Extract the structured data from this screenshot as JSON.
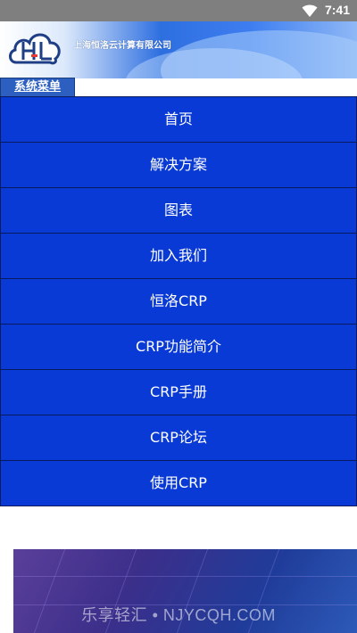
{
  "status_bar": {
    "time": "7:41",
    "icons": [
      "wifi-icon"
    ],
    "background": "#7f7f7f"
  },
  "header": {
    "company_name": "上海恒洛云计算有限公司",
    "logo": "hl-cloud-logo"
  },
  "menu": {
    "tab_label": "系统菜单",
    "items": [
      {
        "label": "首页"
      },
      {
        "label": "解决方案"
      },
      {
        "label": "图表"
      },
      {
        "label": "加入我们"
      },
      {
        "label": "恒洛CRP"
      },
      {
        "label": "CRP功能简介"
      },
      {
        "label": "CRP手册"
      },
      {
        "label": "CRP论坛"
      },
      {
        "label": "使用CRP"
      }
    ],
    "item_color": "#0a3ad6"
  },
  "watermark": "乐享轻汇 • NJYCQH.COM"
}
